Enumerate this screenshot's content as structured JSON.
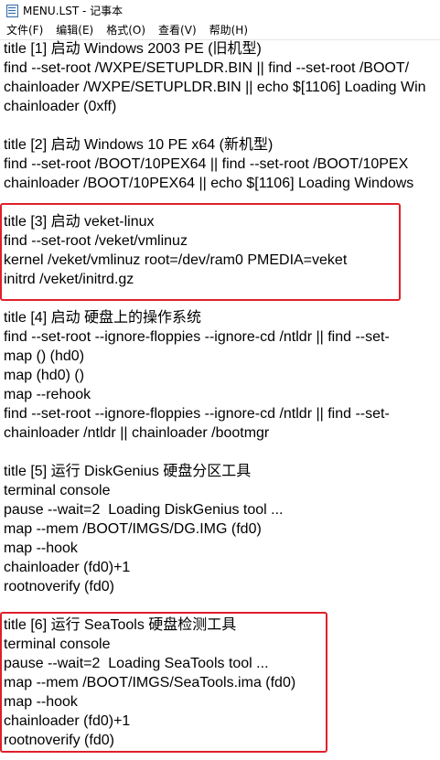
{
  "window": {
    "title": "MENU.LST - 记事本",
    "icon": "notepad-icon"
  },
  "menu": [
    "文件(F)",
    "编辑(E)",
    "格式(O)",
    "查看(V)",
    "帮助(H)"
  ],
  "lines": [
    "title [1] 启动 Windows 2003 PE (旧机型)",
    "find --set-root /WXPE/SETUPLDR.BIN || find --set-root /BOOT/",
    "chainloader /WXPE/SETUPLDR.BIN || echo $[1106] Loading Win",
    "chainloader (0xff)",
    "",
    "title [2] 启动 Windows 10 PE x64 (新机型)",
    "find --set-root /BOOT/10PEX64 || find --set-root /BOOT/10PEX",
    "chainloader /BOOT/10PEX64 || echo $[1106] Loading Windows",
    "",
    "title [3] 启动 veket-linux",
    "find --set-root /veket/vmlinuz",
    "kernel /veket/vmlinuz root=/dev/ram0 PMEDIA=veket",
    "initrd /veket/initrd.gz",
    "",
    "title [4] 启动 硬盘上的操作系统",
    "find --set-root --ignore-floppies --ignore-cd /ntldr || find --set-",
    "map () (hd0)",
    "map (hd0) ()",
    "map --rehook",
    "find --set-root --ignore-floppies --ignore-cd /ntldr || find --set-",
    "chainloader /ntldr || chainloader /bootmgr",
    "",
    "title [5] 运行 DiskGenius 硬盘分区工具",
    "terminal console",
    "pause --wait=2  Loading DiskGenius tool ...",
    "map --mem /BOOT/IMGS/DG.IMG (fd0)",
    "map --hook",
    "chainloader (fd0)+1",
    "rootnoverify (fd0)",
    "",
    "title [6] 运行 SeaTools 硬盘检测工具",
    "terminal console",
    "pause --wait=2  Loading SeaTools tool ...",
    "map --mem /BOOT/IMGS/SeaTools.ima (fd0)",
    "map --hook",
    "chainloader (fd0)+1",
    "rootnoverify (fd0)"
  ],
  "highlight_color": "#e0202a"
}
